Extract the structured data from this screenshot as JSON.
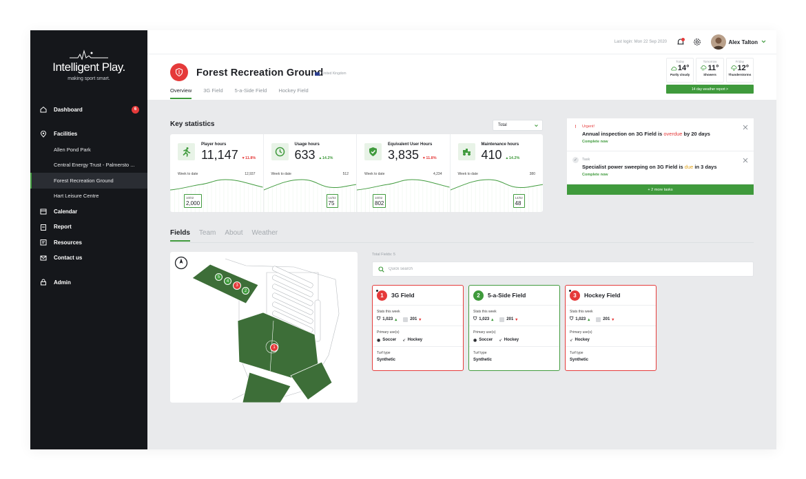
{
  "sidebar": {
    "brand": "Intelligent Play.",
    "tagline": "making sport smart.",
    "items": [
      {
        "label": "Dashboard",
        "badge": "6"
      },
      {
        "label": "Facilities"
      },
      {
        "label": "Calendar"
      },
      {
        "label": "Report"
      },
      {
        "label": "Resources"
      },
      {
        "label": "Contact us"
      },
      {
        "label": "Admin"
      }
    ],
    "facilities": [
      "Allen Pond Park",
      "Central Energy Trust - Palmersto ...",
      "Forest Recreation Ground",
      "Hart Leisure Centre"
    ]
  },
  "topbar": {
    "last_login": "Last login: Mon 22 Sep 2020",
    "user": "Alex Talton"
  },
  "header": {
    "title": "Forest Recreation Ground",
    "country": "United Kingdom",
    "tabs": [
      "Overview",
      "3G Field",
      "5-a-Side Field",
      "Hockey Field"
    ]
  },
  "weather": {
    "days": [
      {
        "day": "Today",
        "temp": "14°",
        "cond": "Partly cloudy"
      },
      {
        "day": "Tomorrow",
        "temp": "11°",
        "cond": "Showers"
      },
      {
        "day": "Friday",
        "temp": "12°",
        "cond": "Thunderstorms"
      }
    ],
    "report_button": "14 day weather report  >"
  },
  "stats": {
    "title": "Key statistics",
    "filter": "Total",
    "cards": [
      {
        "label": "Player hours",
        "value": "11,147",
        "change": "11.8%",
        "dir": "down",
        "wtd_label": "Week to date",
        "wtd": "12,937",
        "tip_date": "10/02",
        "tip_value": "2,000",
        "icon": "runner-icon"
      },
      {
        "label": "Usage hours",
        "value": "633",
        "change": "14.2%",
        "dir": "up",
        "wtd_label": "Week to date",
        "wtd": "512",
        "tip_date": "14/02",
        "tip_value": "75",
        "icon": "clock-icon"
      },
      {
        "label": "Equivalent User Hours",
        "value": "3,835",
        "change": "11.8%",
        "dir": "down",
        "wtd_label": "Week to date",
        "wtd": "4,234",
        "tip_date": "10/02",
        "tip_value": "802",
        "icon": "shield-check-icon"
      },
      {
        "label": "Maintenance hours",
        "value": "410",
        "change": "14.2%",
        "dir": "up",
        "wtd_label": "Week to date",
        "wtd": "380",
        "tip_date": "14/02",
        "tip_value": "48",
        "icon": "tractor-icon"
      }
    ]
  },
  "tasks": {
    "items": [
      {
        "type": "Urgent!",
        "message_pre": "Annual inspection on 3G Field is ",
        "message_hl": "overdue",
        "message_post": " by 20 days",
        "action": "Complete now"
      },
      {
        "type": "Task",
        "message_pre": "Specialist power sweeping on 3G Field is ",
        "message_hl": "due",
        "message_post": " in 3 days",
        "action": "Complete now"
      }
    ],
    "more": "+ 2 more tasks"
  },
  "fields_section": {
    "tabs": [
      "Fields",
      "Team",
      "About",
      "Weather"
    ],
    "total": "Total Fields: 5",
    "search_placeholder": "Quick search",
    "map_markers": [
      "5",
      "4",
      "3",
      "2",
      "1"
    ],
    "cards": [
      {
        "num": "1",
        "name": "3G Field",
        "status": "alert",
        "stats_label": "Stats this week",
        "stat1": "1,023",
        "stat2": "201",
        "uses_label": "Primary use(s)",
        "uses": [
          "Soccer",
          "Hockey"
        ],
        "turf_label": "Turf type",
        "turf": "Synthetic"
      },
      {
        "num": "2",
        "name": "5-a-Side Field",
        "status": "ok",
        "stats_label": "Stats this week",
        "stat1": "1,023",
        "stat2": "201",
        "uses_label": "Primary use(s)",
        "uses": [
          "Soccer",
          "Hockey"
        ],
        "turf_label": "Turf type",
        "turf": "Synthetic"
      },
      {
        "num": "3",
        "name": "Hockey Field",
        "status": "alert",
        "stats_label": "Stats this week",
        "stat1": "1,023",
        "stat2": "201",
        "uses_label": "Primary use(s)",
        "uses": [
          "Hockey"
        ],
        "turf_label": "Turf type",
        "turf": "Synthetic"
      }
    ]
  },
  "colors": {
    "accent": "#3f9a3c",
    "alert": "#e53a3a",
    "sidebar": "#15171b"
  }
}
